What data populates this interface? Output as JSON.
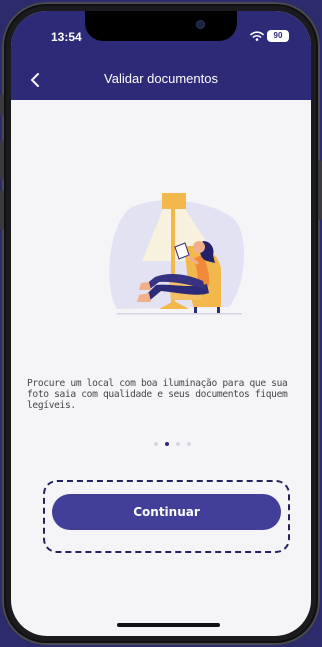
{
  "status_bar": {
    "time": "13:54",
    "battery": "90",
    "wifi_icon": "wifi-icon"
  },
  "header": {
    "title": "Validar documentos",
    "back_icon": "chevron-left-icon"
  },
  "onboarding": {
    "illustration": "person-reading-under-lamp-illustration",
    "description": "Procure um local com boa iluminação para que sua foto saia com qualidade e seus documentos fiquem legíveis.",
    "page_count": 4,
    "active_page": 2
  },
  "actions": {
    "continue_label": "Continuar"
  },
  "colors": {
    "brand": "#2d2a78",
    "button": "#413f97",
    "background": "#f5f5f7"
  }
}
